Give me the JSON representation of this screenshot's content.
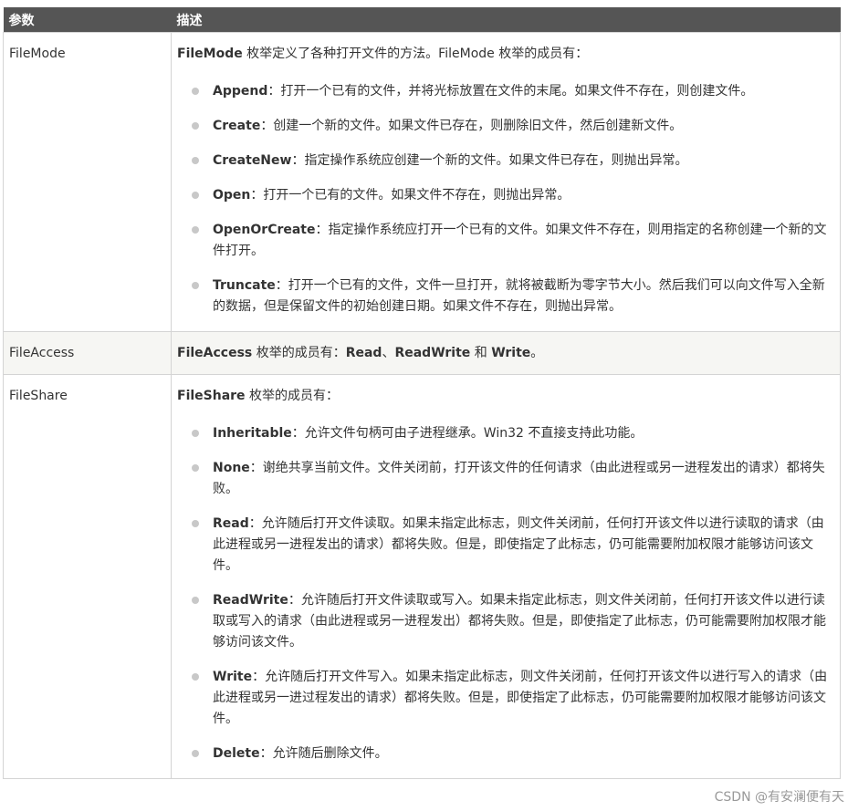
{
  "table": {
    "headers": {
      "param": "参数",
      "desc": "描述"
    },
    "rows": [
      {
        "param": "FileMode",
        "intro_bold": "FileMode",
        "intro_text": " 枚举定义了各种打开文件的方法。FileMode 枚举的成员有：",
        "items": [
          {
            "name": "Append",
            "text": "：打开一个已有的文件，并将光标放置在文件的末尾。如果文件不存在，则创建文件。"
          },
          {
            "name": "Create",
            "text": "：创建一个新的文件。如果文件已存在，则删除旧文件，然后创建新文件。"
          },
          {
            "name": "CreateNew",
            "text": "：指定操作系统应创建一个新的文件。如果文件已存在，则抛出异常。"
          },
          {
            "name": "Open",
            "text": "：打开一个已有的文件。如果文件不存在，则抛出异常。"
          },
          {
            "name": "OpenOrCreate",
            "text": "：指定操作系统应打开一个已有的文件。如果文件不存在，则用指定的名称创建一个新的文件打开。"
          },
          {
            "name": "Truncate",
            "text": "：打开一个已有的文件，文件一旦打开，就将被截断为零字节大小。然后我们可以向文件写入全新的数据，但是保留文件的初始创建日期。如果文件不存在，则抛出异常。"
          }
        ]
      },
      {
        "param": "FileAccess",
        "intro_bold": "FileAccess",
        "intro_text": " 枚举的成员有：",
        "members": [
          "Read",
          "、",
          "ReadWrite",
          " 和 ",
          "Write",
          "。"
        ]
      },
      {
        "param": "FileShare",
        "intro_bold": "FileShare",
        "intro_text": " 枚举的成员有：",
        "items": [
          {
            "name": "Inheritable",
            "text": "：允许文件句柄可由子进程继承。Win32 不直接支持此功能。"
          },
          {
            "name": "None",
            "text": "：谢绝共享当前文件。文件关闭前，打开该文件的任何请求（由此进程或另一进程发出的请求）都将失败。"
          },
          {
            "name": "Read",
            "text": "：允许随后打开文件读取。如果未指定此标志，则文件关闭前，任何打开该文件以进行读取的请求（由此进程或另一进程发出的请求）都将失败。但是，即使指定了此标志，仍可能需要附加权限才能够访问该文件。"
          },
          {
            "name": "ReadWrite",
            "text": "：允许随后打开文件读取或写入。如果未指定此标志，则文件关闭前，任何打开该文件以进行读取或写入的请求（由此进程或另一进程发出）都将失败。但是，即使指定了此标志，仍可能需要附加权限才能够访问该文件。"
          },
          {
            "name": "Write",
            "text": "：允许随后打开文件写入。如果未指定此标志，则文件关闭前，任何打开该文件以进行写入的请求（由此进程或另一进过程发出的请求）都将失败。但是，即使指定了此标志，仍可能需要附加权限才能够访问该文件。"
          },
          {
            "name": "Delete",
            "text": "：允许随后删除文件。"
          }
        ]
      }
    ]
  },
  "watermark": "CSDN @有安澜便有天"
}
